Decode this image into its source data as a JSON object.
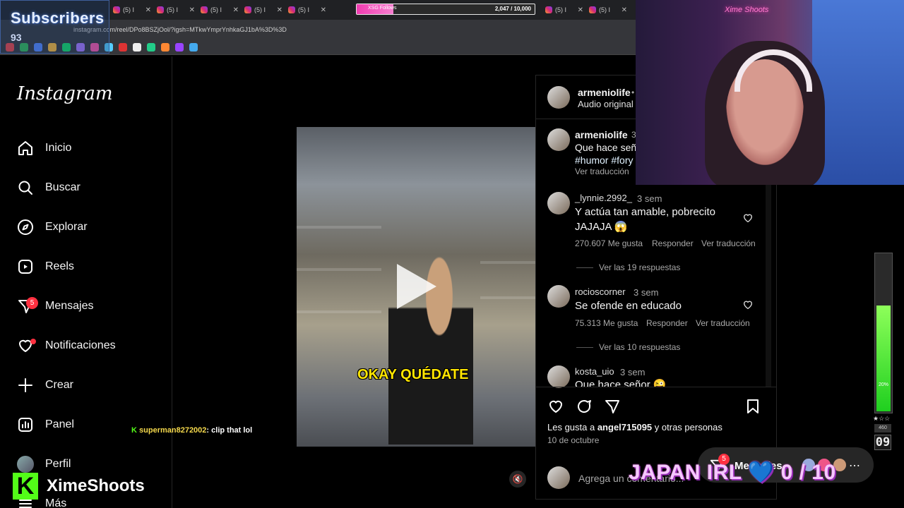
{
  "browser": {
    "tab_label": "(5) I",
    "url": "instagram.com/reel/DPo8BSZjOol/?igsh=MTkwYmprYnhkaGJ1bA%3D%3D",
    "xbar": {
      "label": "XSG Follows",
      "count": "2,047 / 10,000",
      "progress": 0.2047
    }
  },
  "overlay": {
    "subs_title": "Subscribers",
    "subs_count": "93",
    "chat_user": "superman8272002",
    "chat_sep": ": ",
    "chat_text": "clip that lol",
    "streamer": "XimeShoots",
    "kick_logo": "K",
    "goal_text": "JAPAN IRL 💙 0 / 10",
    "neon_sign": "Xime Shoots",
    "meter": {
      "level": 0.68,
      "label": "20%",
      "stars": "★☆☆",
      "value_a": "460",
      "value_b": "09"
    }
  },
  "sidebar": {
    "logo": "Instagram",
    "items": [
      {
        "label": "Inicio",
        "icon": "home-icon"
      },
      {
        "label": "Buscar",
        "icon": "search-icon"
      },
      {
        "label": "Explorar",
        "icon": "compass-icon"
      },
      {
        "label": "Reels",
        "icon": "reels-icon"
      },
      {
        "label": "Mensajes",
        "icon": "messenger-icon",
        "badge": "5"
      },
      {
        "label": "Notificaciones",
        "icon": "heart-icon"
      },
      {
        "label": "Crear",
        "icon": "plus-icon"
      },
      {
        "label": "Panel",
        "icon": "chart-icon"
      },
      {
        "label": "Perfil",
        "icon": "avatar"
      },
      {
        "label": "Más",
        "icon": "menu-icon"
      }
    ]
  },
  "post": {
    "author": "armeniolife",
    "header_dot": "•",
    "audio": "Audio original",
    "caption_user": "armeniolife",
    "caption_time": "3",
    "caption_text": "Que hace señ",
    "caption_tags": "#humor #fory",
    "see_translation": "Ver traducción",
    "video_caption": "OKAY QUÉDATE",
    "comments": [
      {
        "user": "_lynnie.2992_",
        "time": "3 sem",
        "text": "Y actúa tan amable, pobrecito",
        "text2": "JAJAJA 😱",
        "likes": "270.607 Me gusta",
        "reply": "Responder",
        "translate": "Ver traducción",
        "replies": "Ver las 19 respuestas"
      },
      {
        "user": "rocioscorner",
        "time": "3 sem",
        "text": "Se ofende en educado",
        "likes": "75.313 Me gusta",
        "reply": "Responder",
        "translate": "Ver traducción",
        "replies": "Ver las 10 respuestas"
      },
      {
        "user": "kosta_uio",
        "time": "3 sem",
        "text": "Que hace señor 😜"
      }
    ],
    "likes_prefix": "Les gusta a ",
    "likes_user": "angel715095",
    "likes_suffix": " y otras personas",
    "date": "10 de octubre",
    "add_comment_placeholder": "Agrega un comentario..."
  },
  "messages_pill": {
    "label": "Mensajes",
    "badge": "5"
  },
  "colors": {
    "accent": "#ff3040",
    "kick": "#53fc18",
    "link": "#e0f1ff"
  }
}
